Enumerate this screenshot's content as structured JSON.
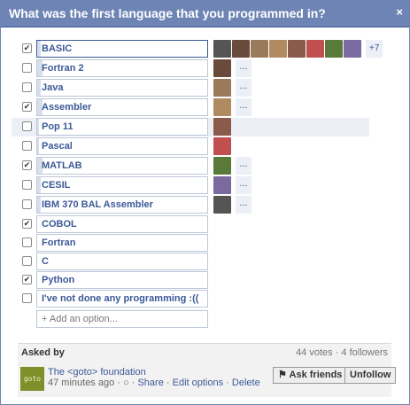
{
  "title": "What was the first language that you programmed in?",
  "close_label": "×",
  "options": [
    {
      "label": "BASIC",
      "checked": true,
      "fill": 0.02,
      "selected": true
    },
    {
      "label": "Fortran 2",
      "checked": false,
      "fill": 0.03
    },
    {
      "label": "Java",
      "checked": false,
      "fill": 0.02
    },
    {
      "label": "Assembler",
      "checked": true,
      "fill": 0.03
    },
    {
      "label": "Pop 11",
      "checked": false,
      "fill": 0.01,
      "highlight": true
    },
    {
      "label": "Pascal",
      "checked": false,
      "fill": 0.01
    },
    {
      "label": "MATLAB",
      "checked": true,
      "fill": 0.03
    },
    {
      "label": "CESIL",
      "checked": false,
      "fill": 0.02
    },
    {
      "label": "IBM 370 BAL Assembler",
      "checked": false,
      "fill": 0.02
    },
    {
      "label": "COBOL",
      "checked": true,
      "fill": 0.0
    },
    {
      "label": "Fortran",
      "checked": false,
      "fill": 0.0
    },
    {
      "label": "C",
      "checked": false,
      "fill": 0.0
    },
    {
      "label": "Python",
      "checked": true,
      "fill": 0.0
    },
    {
      "label": "I've not done any programming :((",
      "checked": false,
      "fill": 0.0
    }
  ],
  "more_label": "...",
  "plus_more": "+7",
  "add_option_placeholder": "+ Add an option...",
  "footer": {
    "asked_by": "Asked by",
    "stats": "44 votes · 4 followers",
    "logo_text": "goto",
    "author": "The <goto> foundation",
    "time": "47 minutes ago",
    "share": "Share",
    "edit": "Edit options",
    "delete": "Delete",
    "ask_friends": "Ask friends",
    "unfollow": "Unfollow"
  },
  "colors": {
    "accent": "#6d84b4",
    "link": "#3b5998"
  }
}
